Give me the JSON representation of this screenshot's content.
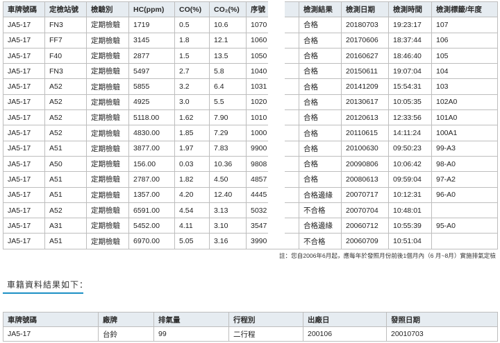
{
  "inspection": {
    "headers": [
      "車牌號碼",
      "定檢站號",
      "檢驗別",
      "HC(ppm)",
      "CO(%)",
      "CO₂(%)",
      "序號",
      "檢測結果",
      "檢測日期",
      "檢測時間",
      "檢測標籤/年度"
    ],
    "rows": [
      [
        "JA5-17",
        "FN3",
        "定期檢驗",
        "1719",
        "0.5",
        "10.6",
        "1070",
        "合格",
        "20180703",
        "19:23:17",
        "107"
      ],
      [
        "JA5-17",
        "FF7",
        "定期檢驗",
        "3145",
        "1.8",
        "12.1",
        "1060",
        "合格",
        "20170606",
        "18:37:44",
        "106"
      ],
      [
        "JA5-17",
        "F40",
        "定期檢驗",
        "2877",
        "1.5",
        "13.5",
        "1050",
        "合格",
        "20160627",
        "18:46:40",
        "105"
      ],
      [
        "JA5-17",
        "FN3",
        "定期檢驗",
        "5497",
        "2.7",
        "5.8",
        "1040",
        "合格",
        "20150611",
        "19:07:04",
        "104"
      ],
      [
        "JA5-17",
        "A52",
        "定期檢驗",
        "5855",
        "3.2",
        "6.4",
        "1031",
        "合格",
        "20141209",
        "15:54:31",
        "103"
      ],
      [
        "JA5-17",
        "A52",
        "定期檢驗",
        "4925",
        "3.0",
        "5.5",
        "1020",
        "合格",
        "20130617",
        "10:05:35",
        "102A0"
      ],
      [
        "JA5-17",
        "A52",
        "定期檢驗",
        "5118.00",
        "1.62",
        "7.90",
        "1010",
        "合格",
        "20120613",
        "12:33:56",
        "101A0"
      ],
      [
        "JA5-17",
        "A52",
        "定期檢驗",
        "4830.00",
        "1.85",
        "7.29",
        "1000",
        "合格",
        "20110615",
        "14:11:24",
        "100A1"
      ],
      [
        "JA5-17",
        "A51",
        "定期檢驗",
        "3877.00",
        "1.97",
        "7.83",
        "9900",
        "合格",
        "20100630",
        "09:50:23",
        "99-A3"
      ],
      [
        "JA5-17",
        "A50",
        "定期檢驗",
        "156.00",
        "0.03",
        "10.36",
        "9808",
        "合格",
        "20090806",
        "10:06:42",
        "98-A0"
      ],
      [
        "JA5-17",
        "A51",
        "定期檢驗",
        "2787.00",
        "1.82",
        "4.50",
        "4857",
        "合格",
        "20080613",
        "09:59:04",
        "97-A2"
      ],
      [
        "JA5-17",
        "A51",
        "定期檢驗",
        "1357.00",
        "4.20",
        "12.40",
        "4445",
        "合格邊緣",
        "20070717",
        "10:12:31",
        "96-A0"
      ],
      [
        "JA5-17",
        "A52",
        "定期檢驗",
        "6591.00",
        "4.54",
        "3.13",
        "5032",
        "不合格",
        "20070704",
        "10:48:01",
        ""
      ],
      [
        "JA5-17",
        "A31",
        "定期檢驗",
        "5452.00",
        "4.11",
        "3.10",
        "3547",
        "合格邊緣",
        "20060712",
        "10:55:39",
        "95-A0"
      ],
      [
        "JA5-17",
        "A51",
        "定期檢驗",
        "6970.00",
        "5.05",
        "3.16",
        "3990",
        "不合格",
        "20060709",
        "10:51:04",
        ""
      ]
    ]
  },
  "note": "註：您自2006年6月起，應每年於發照月份前後1個月內（6 月~8月）實施排氣定檢",
  "section_title": "車籍資料結果如下：",
  "vehicle": {
    "headers": [
      "車牌號碼",
      "廠牌",
      "排氣量",
      "行程別",
      "出廠日",
      "發照日期"
    ],
    "row": [
      "JA5-17",
      "台鈴",
      "99",
      "二行程",
      "200106",
      "20010703"
    ]
  }
}
